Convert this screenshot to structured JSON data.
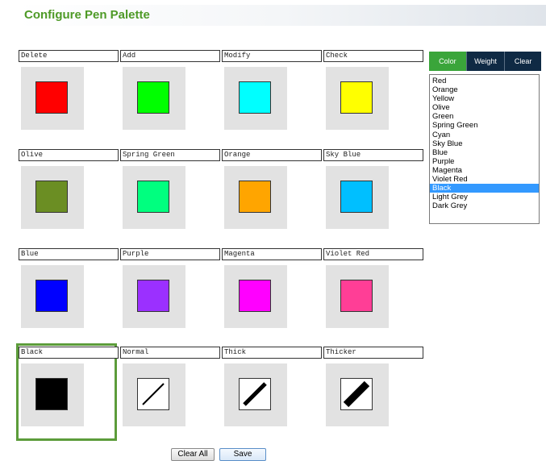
{
  "header": {
    "title": "Configure Pen Palette"
  },
  "grid": [
    [
      {
        "label": "Delete",
        "kind": "color",
        "color": "#ff0000"
      },
      {
        "label": "Add",
        "kind": "color",
        "color": "#00ff00"
      },
      {
        "label": "Modify",
        "kind": "color",
        "color": "#00ffff"
      },
      {
        "label": "Check",
        "kind": "color",
        "color": "#ffff00"
      }
    ],
    [
      {
        "label": "Olive",
        "kind": "color",
        "color": "#6b8e23"
      },
      {
        "label": "Spring Green",
        "kind": "color",
        "color": "#00ff7f"
      },
      {
        "label": "Orange",
        "kind": "color",
        "color": "#ffa500"
      },
      {
        "label": "Sky Blue",
        "kind": "color",
        "color": "#00bfff"
      }
    ],
    [
      {
        "label": "Blue",
        "kind": "color",
        "color": "#0000ff"
      },
      {
        "label": "Purple",
        "kind": "color",
        "color": "#9b30ff"
      },
      {
        "label": "Magenta",
        "kind": "color",
        "color": "#ff00ff"
      },
      {
        "label": "Violet Red",
        "kind": "color",
        "color": "#ff3e96"
      }
    ],
    [
      {
        "label": "Black",
        "kind": "color",
        "color": "#000000",
        "selected": true
      },
      {
        "label": "Normal",
        "kind": "weight",
        "weight": "normal"
      },
      {
        "label": "Thick",
        "kind": "weight",
        "weight": "thick"
      },
      {
        "label": "Thicker",
        "kind": "weight",
        "weight": "thicker"
      }
    ]
  ],
  "tabs": {
    "color": "Color",
    "weight": "Weight",
    "clear": "Clear"
  },
  "colors_list": [
    "Red",
    "Orange",
    "Yellow",
    "Olive",
    "Green",
    "Spring Green",
    "Cyan",
    "Sky Blue",
    "Blue",
    "Purple",
    "Magenta",
    "Violet Red",
    "Black",
    "Light Grey",
    "Dark Grey"
  ],
  "colors_list_selected": "Black",
  "buttons": {
    "clear_all": "Clear All",
    "save": "Save"
  },
  "accent": {
    "header_title": "#4e9a26",
    "selected_frame": "#5c9c3a",
    "tab_active": "#3aa53a",
    "tab_inactive": "#0f2a44",
    "list_highlight": "#3399ff"
  }
}
